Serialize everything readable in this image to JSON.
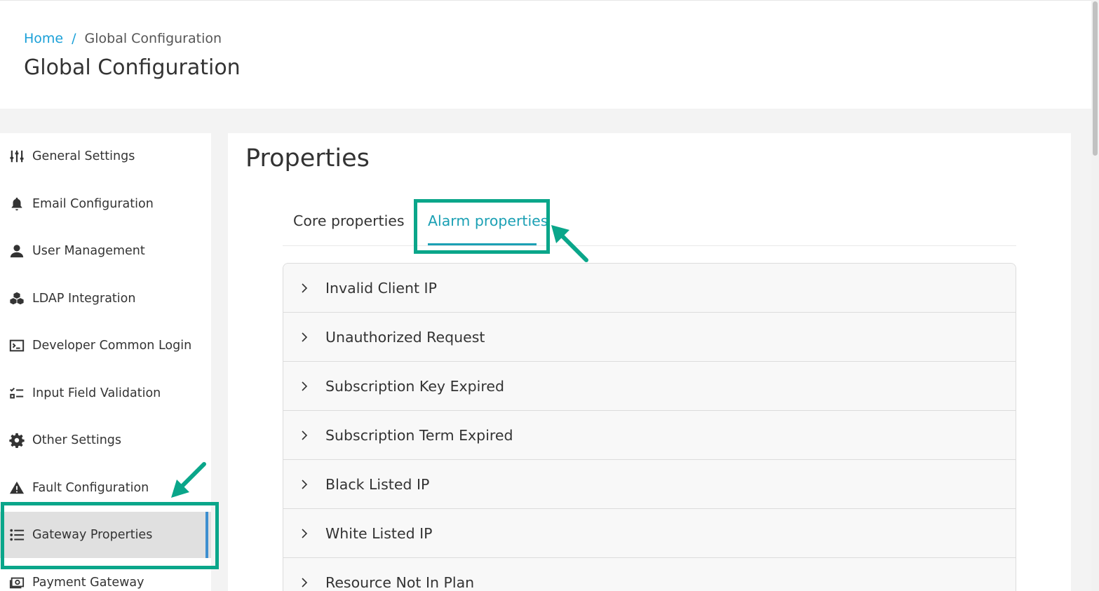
{
  "breadcrumb": {
    "home": "Home",
    "separator": "/",
    "current": "Global Configuration"
  },
  "page_title": "Global Configuration",
  "sidebar": {
    "items": [
      {
        "label": "General Settings",
        "icon": "sliders-icon"
      },
      {
        "label": "Email Configuration",
        "icon": "bell-icon"
      },
      {
        "label": "User Management",
        "icon": "user-icon"
      },
      {
        "label": "LDAP Integration",
        "icon": "cubes-icon"
      },
      {
        "label": "Developer Common Login",
        "icon": "terminal-icon"
      },
      {
        "label": "Input Field Validation",
        "icon": "checklist-icon"
      },
      {
        "label": "Other Settings",
        "icon": "gear-icon"
      },
      {
        "label": "Fault Configuration",
        "icon": "warning-icon"
      },
      {
        "label": "Gateway Properties",
        "icon": "list-icon",
        "active": true
      },
      {
        "label": "Payment Gateway",
        "icon": "money-icon"
      }
    ]
  },
  "content": {
    "title": "Properties",
    "tabs": [
      {
        "label": "Core properties",
        "active": false
      },
      {
        "label": "Alarm properties",
        "active": true
      }
    ],
    "accordion": [
      {
        "label": "Invalid Client IP"
      },
      {
        "label": "Unauthorized Request"
      },
      {
        "label": "Subscription Key Expired"
      },
      {
        "label": "Subscription Term Expired"
      },
      {
        "label": "Black Listed IP"
      },
      {
        "label": "White Listed IP"
      },
      {
        "label": "Resource Not In Plan"
      }
    ]
  },
  "colors": {
    "accent": "#1ba0b4",
    "link": "#1aa0d8",
    "highlight": "#0aa68a",
    "active_bg": "#e0e0e0"
  }
}
